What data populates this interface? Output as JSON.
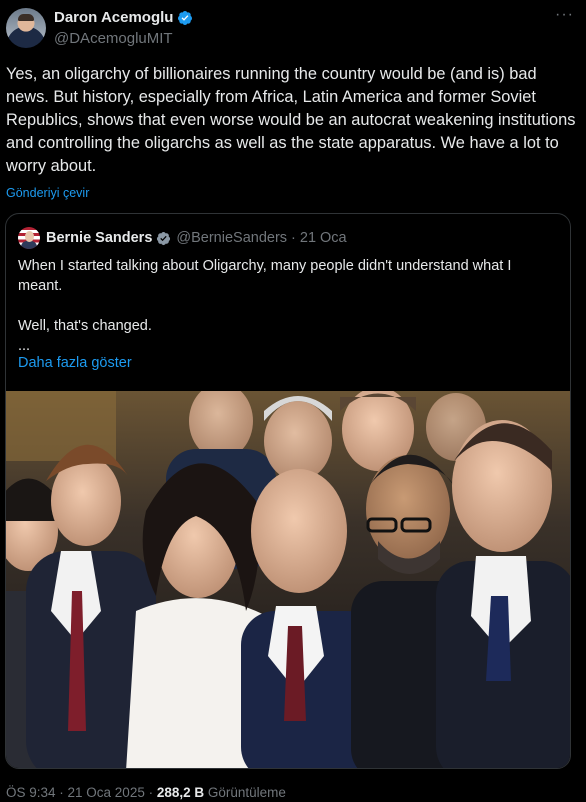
{
  "author": {
    "display_name": "Daron Acemoglu",
    "handle": "@DAcemogluMIT"
  },
  "tweet": {
    "text": "Yes, an oligarchy of billionaires running the country would be (and is) bad news. But history, especially from Africa, Latin America and former Soviet Republics, shows that even worse would be an autocrat weakening institutions and controlling the oligarchs as well as the state apparatus. We have a lot to worry about.",
    "translate_label": "Gönderiyi çevir"
  },
  "quoted": {
    "display_name": "Bernie Sanders",
    "handle": "@BernieSanders",
    "separator": "·",
    "date": "21 Oca",
    "para1": "When I started talking about Oligarchy, many people didn't understand what I meant.",
    "para2": "Well, that's changed.",
    "ellipsis": "...",
    "show_more": "Daha fazla göster"
  },
  "footer": {
    "time_date": "ÖS 9:34 · 21 Oca 2025 · ",
    "views_count": "288,2 B",
    "views_label": " Görüntüleme"
  },
  "icons": {
    "verified": "verified-badge-icon",
    "more": "more-options-icon"
  },
  "colors": {
    "background": "#000000",
    "text": "#e7e9ea",
    "muted": "#71767b",
    "link": "#1d9bf0",
    "verified": "#1d9bf0",
    "quoted_verified": "#8b98a5",
    "border": "#2f3336"
  }
}
